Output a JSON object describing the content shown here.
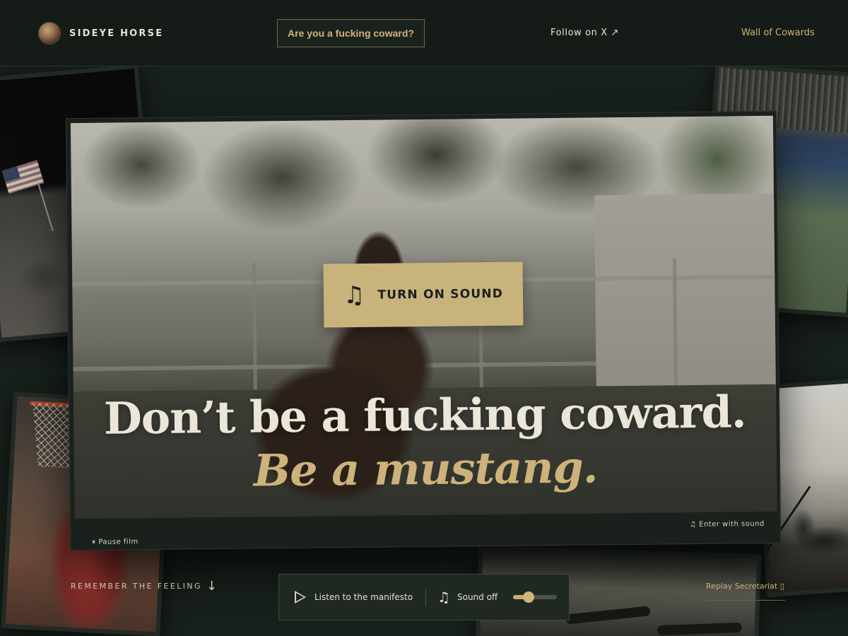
{
  "header": {
    "brand_name": "SIDEYE HORSE",
    "cta_label": "Are you a fucking coward?",
    "follow_label": "Follow on X ↗",
    "wall_label": "Wall of Cowards"
  },
  "hero": {
    "sound_button_label": "TURN ON SOUND",
    "headline": "Don’t be a fucking coward.",
    "subline": "Be a mustang.",
    "pause_label": "⏸ Pause film",
    "enter_sound_label": "♫ Enter with sound"
  },
  "footer": {
    "remember_label": "REMEMBER THE FEELING",
    "remember_arrow": "↓",
    "manifesto_label": "Listen to the manifesto",
    "sound_off_label": "Sound off",
    "volume_level": 0.35,
    "replay_label": "Replay Secretariat ▯"
  },
  "icons": {
    "sound_note": "♫",
    "small_note": "♫"
  },
  "colors": {
    "accent_gold": "#c9b37d",
    "background": "#18201b",
    "header_bg": "#151c18"
  }
}
